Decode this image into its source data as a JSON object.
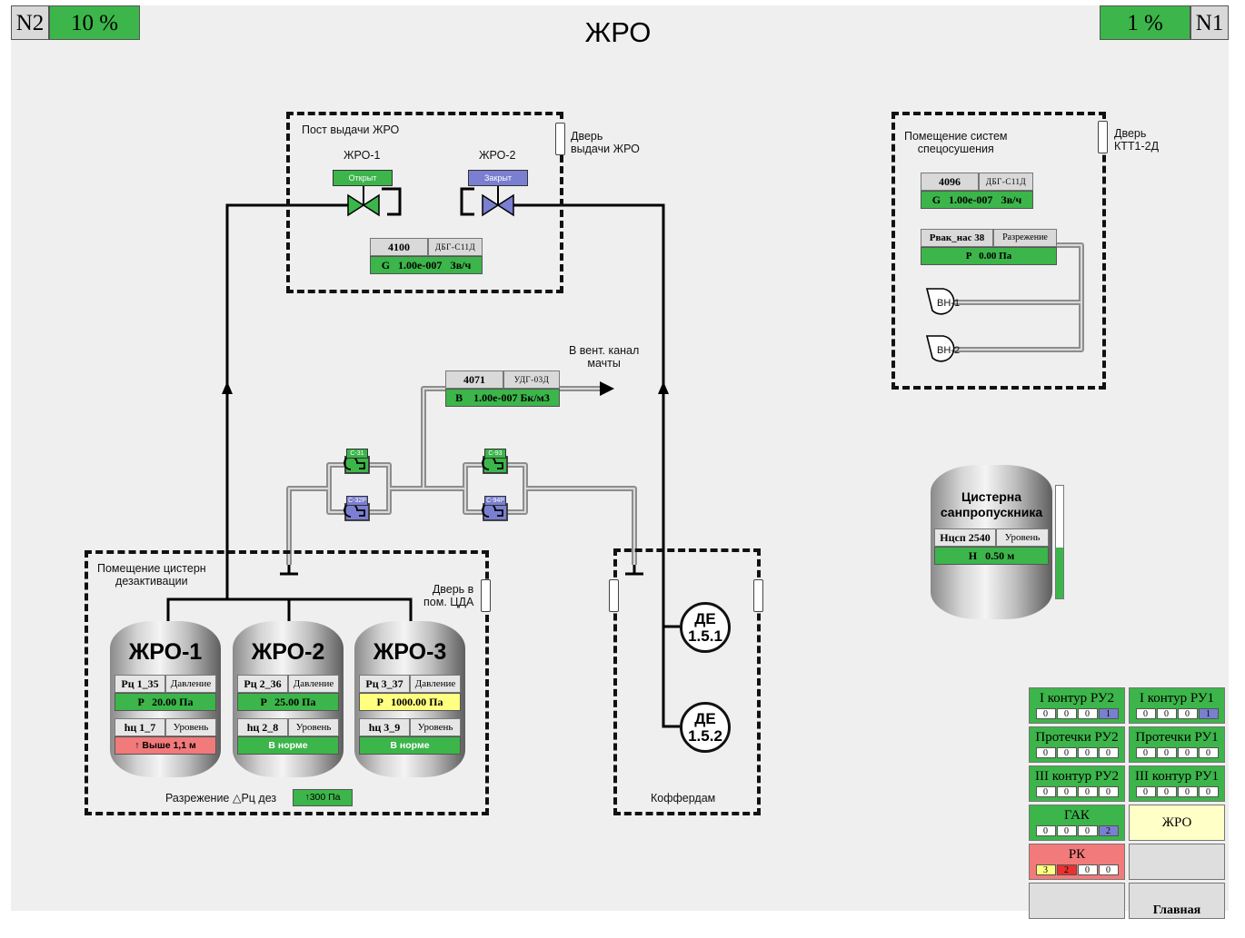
{
  "header": {
    "left_id": "N2",
    "left_percent": "10 %",
    "title": "ЖРО",
    "right_percent": "1 %",
    "right_id": "N1"
  },
  "colors": {
    "green": "#3cb54a",
    "blue": "#7a7fd1",
    "yellow": "#ffff80",
    "red": "#f27a7a",
    "grey": "#d9d9d9"
  },
  "post": {
    "title": "Пост выдачи ЖРО",
    "door_label": "Дверь\nвыдачи ЖРО",
    "valve1": {
      "name": "ЖРО-1",
      "state": "Открыт"
    },
    "valve2": {
      "name": "ЖРО-2",
      "state": "Закрыт"
    },
    "sensor": {
      "id": "4100",
      "type": "ДБГ-С11Д",
      "value": "G   1.00е-007   Зв/ч"
    }
  },
  "vent": {
    "label": "В вент. канал\nмачты",
    "sensor": {
      "id": "4071",
      "type": "УДГ-03Д",
      "value": "B    1.00е-007 Бк/м3"
    },
    "valves": [
      "С-31",
      "С-32Р",
      "С-93",
      "С-94Р"
    ]
  },
  "spec": {
    "title": "Помещение систем\nспецосушения",
    "door_label": "Дверь\nКТТ1-2Д",
    "sensor": {
      "id": "4096",
      "type": "ДБГ-С11Д",
      "value": "G   1.00е-007   Зв/ч"
    },
    "vac": {
      "name": "Рвак_нас 38",
      "param": "Разрежение",
      "value": "P   0.00 Па"
    },
    "pumps": [
      "ВН-1",
      "ВН-2"
    ]
  },
  "decon": {
    "title": "Помещение цистерн\nдезактивации",
    "door_label": "Дверь в\nпом. ЦДА",
    "vacuum_label": "Разрежение △Рц дез",
    "vacuum_value": "↑300 Па",
    "tanks": [
      {
        "name": "ЖРО-1",
        "p_id": "Рц 1_35",
        "p_param": "Давление",
        "p_value": "P   20.00 Па",
        "h_id": "hц 1_7",
        "h_param": "Уровень",
        "h_value": "↑ Выше 1,1 м"
      },
      {
        "name": "ЖРО-2",
        "p_id": "Рц 2_36",
        "p_param": "Давление",
        "p_value": "P   25.00 Па",
        "h_id": "hц 2_8",
        "h_param": "Уровень",
        "h_value": "В норме"
      },
      {
        "name": "ЖРО-3",
        "p_id": "Рц 3_37",
        "p_param": "Давление",
        "p_value": "P   1000.00 Па",
        "h_id": "hц 3_9",
        "h_param": "Уровень",
        "h_value": "В норме"
      }
    ]
  },
  "cofferdam": {
    "label": "Коффердам",
    "de1": "ДЕ\n1.5.1",
    "de2": "ДЕ\n1.5.2"
  },
  "sanitary": {
    "name": "Цистерна\nсанпропускника",
    "h_id": "Нцсп 2540",
    "h_param": "Уровень",
    "h_value": "H   0.50 м",
    "level_fraction": 0.45
  },
  "panels": [
    {
      "title": "I контур РУ2",
      "counts": [
        "0",
        "0",
        "0",
        "1"
      ],
      "color": "green"
    },
    {
      "title": "I контур РУ1",
      "counts": [
        "0",
        "0",
        "0",
        "1"
      ],
      "color": "green"
    },
    {
      "title": "Протечки РУ2",
      "counts": [
        "0",
        "0",
        "0",
        "0"
      ],
      "color": "green"
    },
    {
      "title": "Протечки РУ1",
      "counts": [
        "0",
        "0",
        "0",
        "0"
      ],
      "color": "green"
    },
    {
      "title": "III контур РУ2",
      "counts": [
        "0",
        "0",
        "0",
        "0"
      ],
      "color": "green"
    },
    {
      "title": "III контур РУ1",
      "counts": [
        "0",
        "0",
        "0",
        "0"
      ],
      "color": "green"
    },
    {
      "title": "ГАК",
      "counts": [
        "0",
        "0",
        "0",
        "2"
      ],
      "color": "green"
    },
    {
      "title": "ЖРО",
      "counts": [],
      "color": "yellow"
    },
    {
      "title": "РК",
      "counts": [
        "3",
        "2",
        "0",
        "0"
      ],
      "color": "red"
    },
    {
      "title": "",
      "counts": [],
      "color": "grey"
    },
    {
      "title": "",
      "counts": [],
      "color": "grey"
    },
    {
      "title": "Главная",
      "counts": [],
      "color": "grey"
    }
  ]
}
